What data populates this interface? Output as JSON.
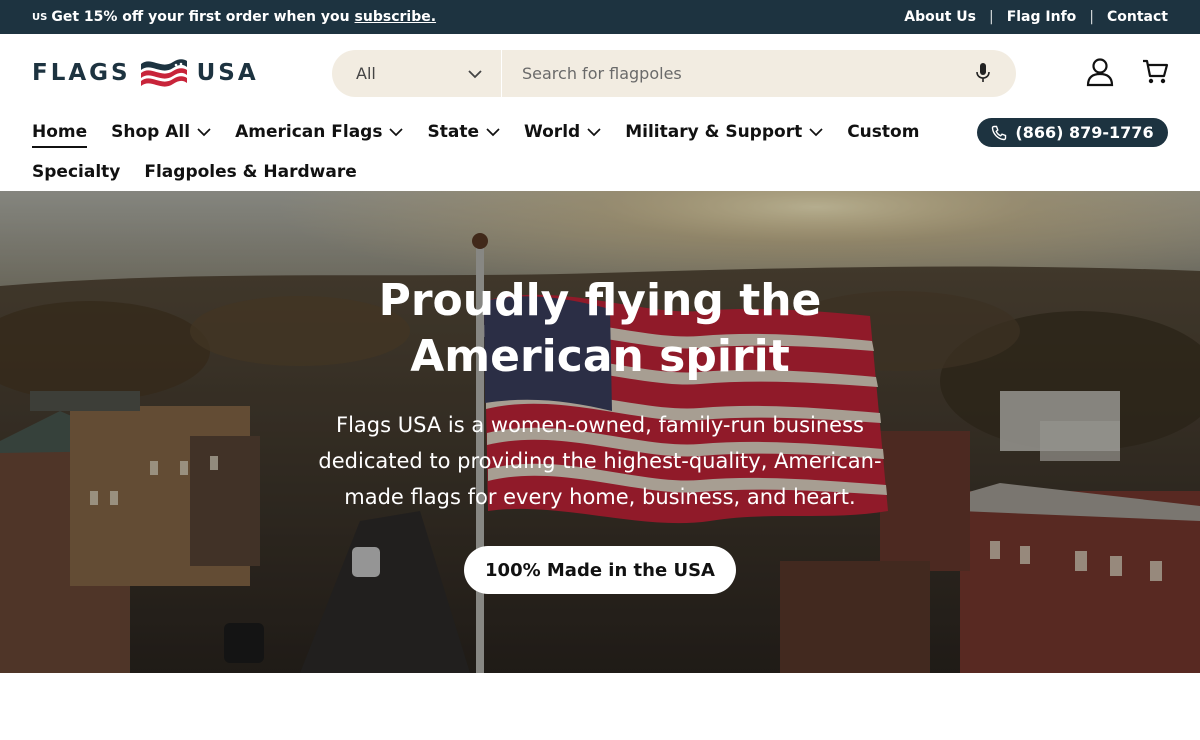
{
  "announcement": {
    "flag_text": "US",
    "text": "Get 15% off your first order when you",
    "link": "subscribe.",
    "links": [
      {
        "label": "About Us"
      },
      {
        "label": "Flag Info"
      },
      {
        "label": "Contact"
      }
    ]
  },
  "header": {
    "logo_left": "FLAGS",
    "logo_right": "USA",
    "search": {
      "category": "All",
      "placeholder": "Search for flagpoles"
    },
    "icons": [
      "account-icon",
      "cart-icon",
      "microphone-icon"
    ]
  },
  "nav": {
    "row1": [
      {
        "label": "Home",
        "dropdown": false
      },
      {
        "label": "Shop All",
        "dropdown": true
      },
      {
        "label": "American Flags",
        "dropdown": true
      },
      {
        "label": "State",
        "dropdown": true
      },
      {
        "label": "World",
        "dropdown": true
      },
      {
        "label": "Military & Support",
        "dropdown": true
      },
      {
        "label": "Custom",
        "dropdown": false
      }
    ],
    "row2": [
      {
        "label": "Specialty",
        "dropdown": false
      },
      {
        "label": "Flagpoles & Hardware",
        "dropdown": false
      }
    ],
    "phone": "(866) 879-1776"
  },
  "hero": {
    "title_line1": "Proudly flying the",
    "title_line2": "American spirit",
    "text_line1": "Flags USA is a women-owned, family-run business",
    "text_line2": "dedicated to providing the highest-quality, American-",
    "text_line3": "made flags for every home, business, and heart.",
    "cta": "100% Made in the USA"
  },
  "colors": {
    "brand_navy": "#1d3340",
    "search_bg": "#f2ece1",
    "flag_red": "#c8243a"
  }
}
